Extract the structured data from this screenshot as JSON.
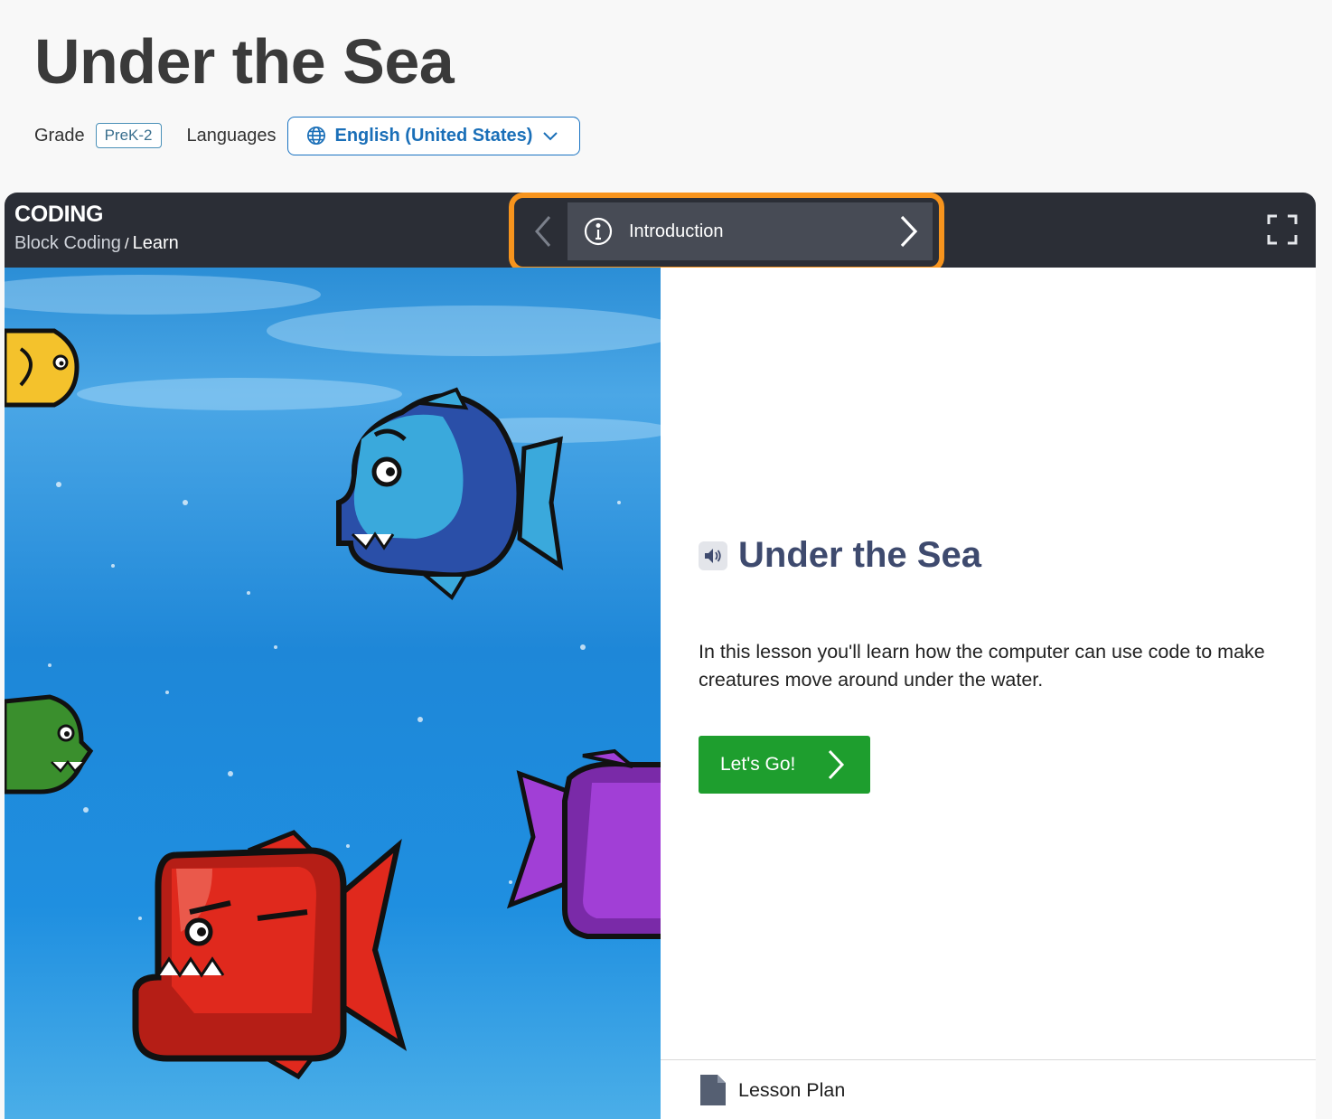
{
  "page": {
    "title": "Under the Sea",
    "grade_label": "Grade",
    "grade_value": "PreK-2",
    "languages_label": "Languages",
    "language_selected": "English (United States)"
  },
  "player": {
    "course": "CODING",
    "breadcrumb": {
      "section": "Block Coding",
      "separator": "/",
      "current": "Learn"
    },
    "step_nav": {
      "current_step": "Introduction"
    }
  },
  "lesson": {
    "title": "Under the Sea",
    "description": "In this lesson you'll learn how the computer can use code to make creatures move around under the water.",
    "cta_label": "Let's Go!",
    "lesson_plan_label": "Lesson Plan"
  },
  "icons": [
    "globe-icon",
    "chevron-down-icon",
    "chevron-left-icon",
    "info-icon",
    "chevron-right-icon",
    "fullscreen-icon",
    "speaker-icon",
    "document-icon"
  ],
  "colors": {
    "accent_blue": "#1a73c2",
    "highlight_orange": "#f7941d",
    "topbar": "#2b2e36",
    "cta_green": "#1e9e2e",
    "heading_navy": "#3e4a6e"
  }
}
